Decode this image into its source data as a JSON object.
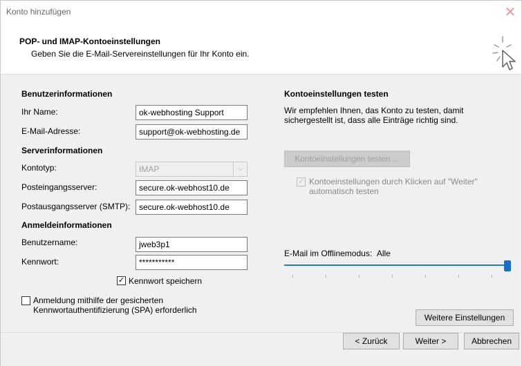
{
  "window": {
    "title": "Konto hinzufügen",
    "close_glyph": "✕"
  },
  "header": {
    "title": "POP- und IMAP-Kontoeinstellungen",
    "subtitle": "Geben Sie die E-Mail-Servereinstellungen für Ihr Konto ein.",
    "icon": "wizard-cursor-icon"
  },
  "user_info": {
    "section": "Benutzerinformationen",
    "name_label": "Ihr Name:",
    "name_value": "ok-webhosting Support",
    "email_label": "E-Mail-Adresse:",
    "email_value": "support@ok-webhosting.de"
  },
  "server_info": {
    "section": "Serverinformationen",
    "account_type_label": "Kontotyp:",
    "account_type_value": "IMAP",
    "incoming_label": "Posteingangsserver:",
    "incoming_value": "secure.ok-webhost10.de",
    "outgoing_label": "Postausgangsserver (SMTP):",
    "outgoing_value": "secure.ok-webhost10.de"
  },
  "login_info": {
    "section": "Anmeldeinformationen",
    "username_label": "Benutzername:",
    "username_value": "jweb3p1",
    "password_label": "Kennwort:",
    "password_value": "***********",
    "save_password_label": "Kennwort speichern",
    "save_password_checked": true,
    "spa_label_line1": "Anmeldung mithilfe der gesicherten",
    "spa_label_line2": "Kennwortauthentifizierung (SPA) erforderlich",
    "spa_checked": false
  },
  "test": {
    "section": "Kontoeinstellungen testen",
    "desc_line1": "Wir empfehlen Ihnen, das Konto zu testen, damit",
    "desc_line2": "sichergestellt ist, dass alle Einträge richtig sind.",
    "test_button": "Kontoeinstellungen testen ...",
    "auto_test_line1": "Kontoeinstellungen durch Klicken auf \"Weiter\"",
    "auto_test_line2": "automatisch testen",
    "auto_test_checked": true
  },
  "offline": {
    "label": "E-Mail im Offlinemodus:",
    "value": "Alle",
    "slider_level": 1.0
  },
  "more_settings_button": "Weitere Einstellungen",
  "footer": {
    "back": "< Zurück",
    "next": "Weiter >",
    "cancel": "Abbrechen"
  },
  "colors": {
    "accent": "#1e7bd6",
    "panel": "#f0f0f0"
  }
}
